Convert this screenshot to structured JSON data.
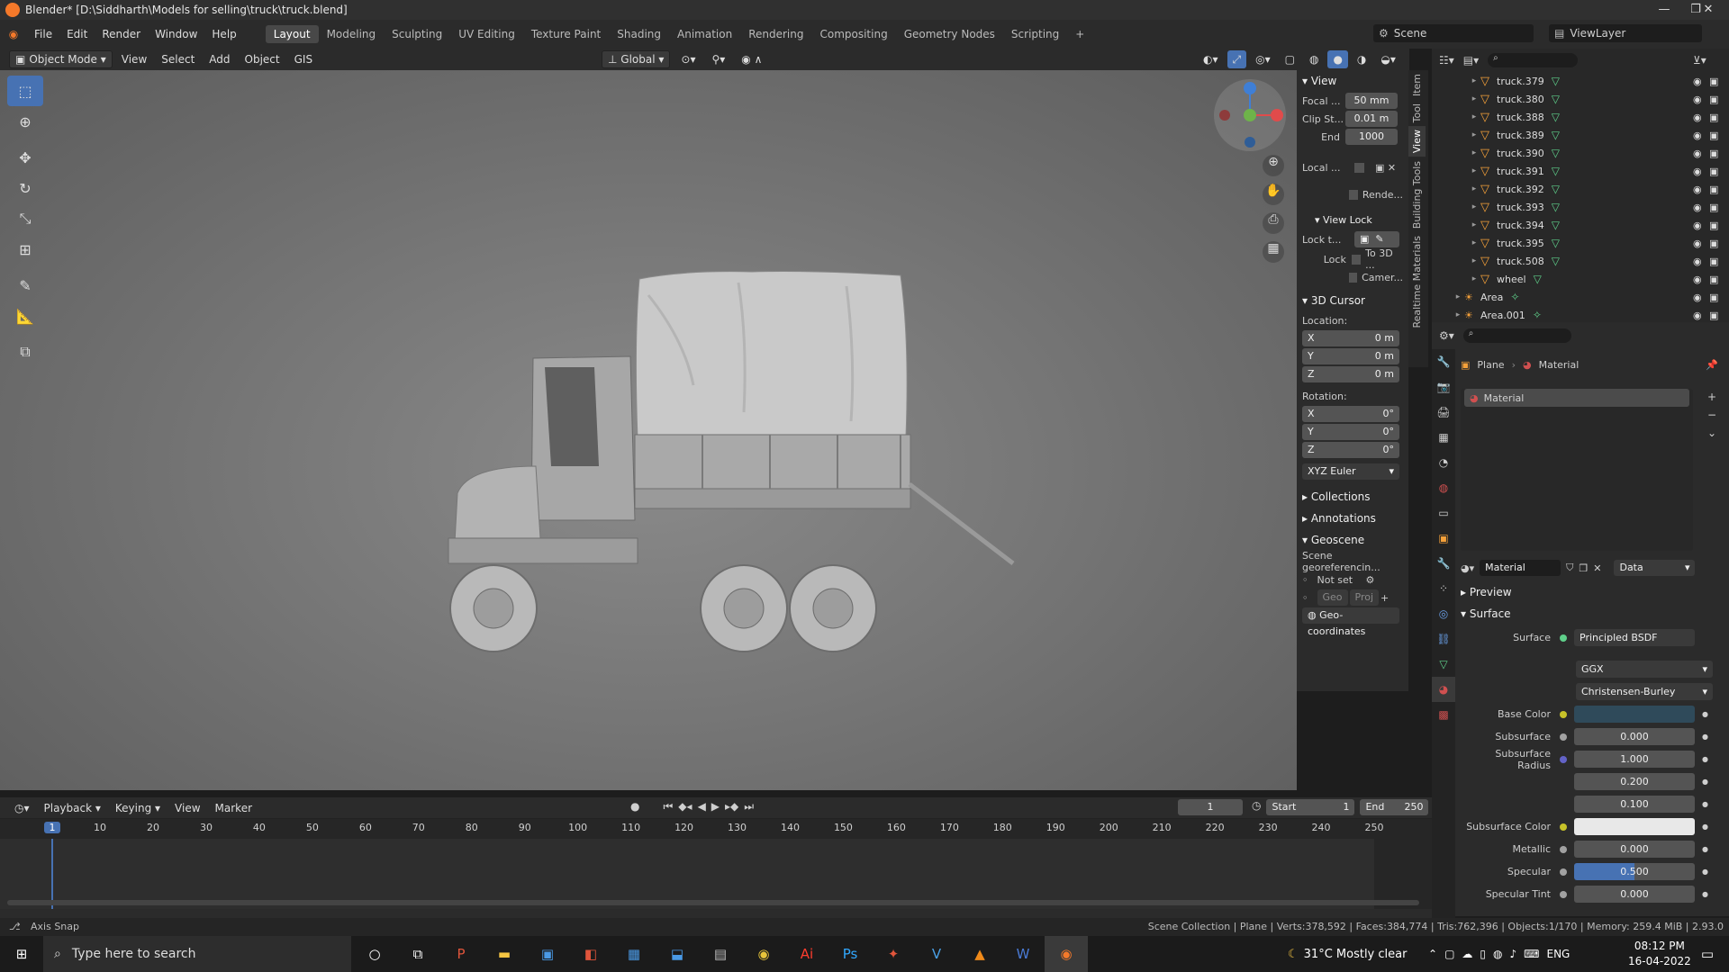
{
  "window": {
    "title": "Blender* [D:\\Siddharth\\Models for selling\\truck\\truck.blend]",
    "min": "—",
    "max": "❐",
    "close": "✕"
  },
  "menu": [
    "File",
    "Edit",
    "Render",
    "Window",
    "Help"
  ],
  "workspaces": [
    "Layout",
    "Modeling",
    "Sculpting",
    "UV Editing",
    "Texture Paint",
    "Shading",
    "Animation",
    "Rendering",
    "Compositing",
    "Geometry Nodes",
    "Scripting",
    "+"
  ],
  "scene": {
    "name": "Scene",
    "view_layer": "ViewLayer"
  },
  "header3d": {
    "mode": "Object Mode",
    "view": "View",
    "select": "Select",
    "add": "Add",
    "object": "Object",
    "gis": "GIS",
    "orientation": "Global"
  },
  "npanel": {
    "view_title": "View",
    "focal_label": "Focal ...",
    "focal_value": "50 mm",
    "clipstart_label": "Clip St...",
    "clipstart_value": "0.01 m",
    "end_label": "End",
    "end_value": "1000",
    "local_label": "Local ...",
    "render_label": "Rende...",
    "viewlock_title": "View Lock",
    "lockt_label": "Lock t...",
    "lock_label": "Lock",
    "to3d_label": "To 3D ...",
    "camera_label": "Camer...",
    "cursor_title": "3D Cursor",
    "location_label": "Location:",
    "loc": [
      {
        "axis": "X",
        "value": "0 m"
      },
      {
        "axis": "Y",
        "value": "0 m"
      },
      {
        "axis": "Z",
        "value": "0 m"
      }
    ],
    "rotation_label": "Rotation:",
    "rot": [
      {
        "axis": "X",
        "value": "0°"
      },
      {
        "axis": "Y",
        "value": "0°"
      },
      {
        "axis": "Z",
        "value": "0°"
      }
    ],
    "euler": "XYZ Euler",
    "collections": "Collections",
    "annotations": "Annotations",
    "geoscene": "Geoscene",
    "geo_text": "Scene georeferencin...",
    "not_set": "Not set",
    "geo": "Geo",
    "proj": "Proj",
    "geocoords": "Geo-coordinates",
    "tabs": [
      "Item",
      "Tool",
      "View",
      "Building Tools",
      "Realtime Materials"
    ]
  },
  "outliner": {
    "items": [
      "truck.379",
      "truck.380",
      "truck.388",
      "truck.389",
      "truck.390",
      "truck.391",
      "truck.392",
      "truck.393",
      "truck.394",
      "truck.395",
      "truck.508",
      "wheel"
    ],
    "lights": [
      "Area",
      "Area.001"
    ]
  },
  "properties": {
    "breadcrumb_obj": "Plane",
    "breadcrumb_mat": "Material",
    "slot": "Material",
    "mat_name": "Material",
    "link": "Data",
    "preview": "Preview",
    "surface_section": "Surface",
    "surface_label": "Surface",
    "surface_value": "Principled BSDF",
    "dist": "GGX",
    "sss_method": "Christensen-Burley",
    "rows": [
      {
        "label": "Base Color",
        "value": "",
        "dot": "#c7c229",
        "kind": "color",
        "color": "#2f4a5a"
      },
      {
        "label": "Subsurface",
        "value": "0.000",
        "dot": "#a1a1a1"
      },
      {
        "label": "Subsurface Radius",
        "value": "1.000",
        "dot": "#6363c7"
      },
      {
        "label": "",
        "value": "0.200",
        "dot": ""
      },
      {
        "label": "",
        "value": "0.100",
        "dot": ""
      },
      {
        "label": "Subsurface Color",
        "value": "",
        "dot": "#c7c229",
        "kind": "color",
        "color": "#e8e8e8"
      },
      {
        "label": "Metallic",
        "value": "0.000",
        "dot": "#a1a1a1"
      },
      {
        "label": "Specular",
        "value": "0.500",
        "dot": "#a1a1a1",
        "kind": "bar"
      },
      {
        "label": "Specular Tint",
        "value": "0.000",
        "dot": "#a1a1a1"
      }
    ],
    "specular_fill": 0.5
  },
  "timeline": {
    "playback": "Playback",
    "keying": "Keying",
    "view": "View",
    "marker": "Marker",
    "current": "1",
    "start_label": "Start",
    "start": "1",
    "end_label": "End",
    "end": "250",
    "ticks": [
      "1",
      "10",
      "20",
      "30",
      "40",
      "50",
      "60",
      "70",
      "80",
      "90",
      "100",
      "110",
      "120",
      "130",
      "140",
      "150",
      "160",
      "170",
      "180",
      "190",
      "200",
      "210",
      "220",
      "230",
      "240",
      "250"
    ]
  },
  "status": {
    "left": "Axis Snap",
    "right": "Scene Collection | Plane | Verts:378,592 | Faces:384,774 | Tris:762,396 | Objects:1/170 | Memory: 259.4 MiB | 2.93.0"
  },
  "taskbar": {
    "search": "Type here to search",
    "weather": "31°C  Mostly clear",
    "lang": "ENG",
    "time": "08:12 PM",
    "date": "16-04-2022"
  }
}
